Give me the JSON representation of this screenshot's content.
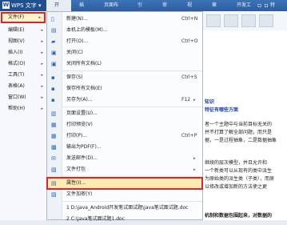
{
  "app": {
    "menu_button": "WPS 文字",
    "logo_glyph": "W"
  },
  "ribbon_tabs": [
    "开始",
    "插入",
    "页面布局",
    "引用",
    "审阅",
    "视图",
    "章节",
    "开发工具",
    "特色"
  ],
  "left_menu": [
    {
      "label": "文件(F)",
      "selected": true
    },
    {
      "label": "编辑(E)"
    },
    {
      "label": "视图(V)"
    },
    {
      "label": "插入(I)"
    },
    {
      "label": "格式(O)"
    },
    {
      "label": "工具(T)"
    },
    {
      "label": "表格(A)"
    },
    {
      "label": "窗口(W)"
    },
    {
      "label": "帮助(H)"
    }
  ],
  "file_menu": [
    {
      "label": "新建(N)...",
      "shortcut": "Ctrl+N",
      "icon": "new-doc-icon",
      "glyph": "▯"
    },
    {
      "label": "本机上的模板(M)...",
      "icon": "template-icon",
      "glyph": "▤"
    },
    {
      "label": "打开(O)...",
      "shortcut": "Ctrl+O",
      "icon": "open-folder-icon",
      "glyph": "▰"
    },
    {
      "label": "关闭(C)",
      "icon": "close-doc-icon",
      "glyph": "▣"
    },
    {
      "label": "关闭所有文档(L)",
      "icon": "close-all-icon",
      "glyph": "▣"
    },
    {
      "label": "保存(S)",
      "shortcut": "Ctrl+S",
      "icon": "save-icon",
      "glyph": "▪"
    },
    {
      "label": "保存所有文档(E)",
      "icon": "save-all-icon",
      "glyph": "▪"
    },
    {
      "label": "另存为(A)...",
      "shortcut": "F12",
      "icon": "save-as-icon",
      "glyph": "▪"
    },
    {
      "label": "页面设置(U)...",
      "icon": "page-setup-icon",
      "glyph": "▥"
    },
    {
      "label": "打印预览(V)",
      "icon": "print-preview-icon",
      "glyph": "▦"
    },
    {
      "label": "打印(P)...",
      "shortcut": "Ctrl+P",
      "icon": "print-icon",
      "glyph": "▦"
    },
    {
      "label": "输出为PDF(F)...",
      "icon": "pdf-icon",
      "glyph": "▩"
    },
    {
      "label": "发送邮件(D)...",
      "icon": "mail-icon",
      "glyph": "✉"
    },
    {
      "label": "文件打包",
      "icon": "package-icon",
      "glyph": "▧"
    },
    {
      "label": "属性(I)...",
      "icon": "properties-icon",
      "glyph": "▤",
      "highlighted": true
    },
    {
      "label": "文件加密(Y)",
      "icon": "encrypt-icon",
      "glyph": "▨"
    },
    {
      "label": "1 D:\\java_Android开发笔试面试题\\java笔试面试题.doc"
    },
    {
      "label": "2 C:\\java笔试面试题1.doc"
    }
  ],
  "document": {
    "lines": [
      "知识",
      "特征有哪些方面",
      "者一个主题中与当前目标无关的",
      "并不打算了解全部问题，而只是",
      "据，一是过程抽象，二是数据抽象",
      "继续的层次模型，并且允许和",
      "一个新类可以从现有的类中派生",
      "为原始类的派生类（子类），而原",
      "以修改或增加新的方法使之更",
      "机制和数据包围起来，对数据的"
    ]
  }
}
